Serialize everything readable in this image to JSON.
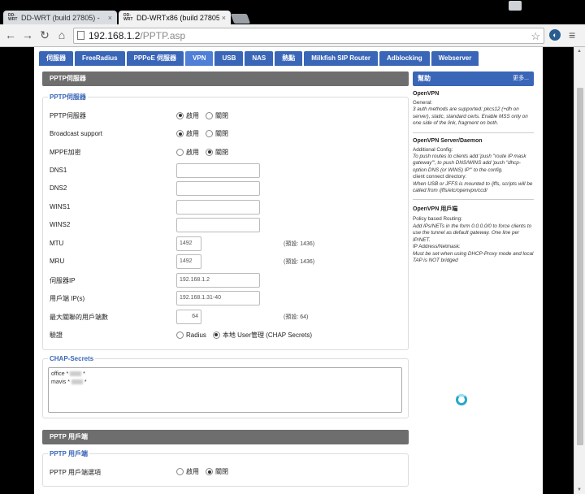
{
  "browser": {
    "tabs": [
      {
        "title": "DD-WRT (build 27805) - ",
        "favicon": "DD-WRT",
        "close": "×"
      },
      {
        "title": "DD-WRTx86 (build 27805",
        "favicon": "DD-WRT",
        "close": "×"
      }
    ],
    "url_host": "192.168.1.2",
    "url_path": "/PPTP.asp"
  },
  "nav": [
    "伺服器",
    "FreeRadius",
    "PPPoE 伺服器",
    "VPN",
    "USB",
    "NAS",
    "熱點",
    "Milkfish SIP Router",
    "Adblocking",
    "Webserver"
  ],
  "pptp_server": {
    "header": "PPTP伺服器",
    "legend": "PPTP伺服器",
    "enable": "啟用",
    "disable": "關閉",
    "rows": {
      "server": "PPTP伺服器",
      "broadcast": "Broadcast support",
      "mppe": "MPPE加密",
      "dns1": "DNS1",
      "dns2": "DNS2",
      "wins1": "WINS1",
      "wins2": "WINS2",
      "mtu": "MTU",
      "mru": "MRU",
      "server_ip": "伺服器IP",
      "client_ip": "用戶端 IP(s)",
      "max_conn": "最大關聯的用戶端數",
      "auth": "驗證"
    },
    "values": {
      "mtu": "1492",
      "mru": "1492",
      "server_ip": "192.168.1.2",
      "client_ip": "192.168.1.31-40",
      "max_conn": "64"
    },
    "hints": {
      "mtu": "(預設: 1436)",
      "mru": "(預設: 1436)",
      "max_conn": "(預設: 64)"
    },
    "auth_radius": "Radius",
    "auth_local": "本地 User管理 (CHAP Secrets)"
  },
  "chap": {
    "legend": "CHAP-Secrets",
    "line1_user": "office * ",
    "line1_end": " *",
    "line2_user": "mavis * ",
    "line2_end": " *"
  },
  "pptp_client": {
    "header": "PPTP 用戶端",
    "legend": "PPTP 用戶端",
    "option_label": "PPTP 用戶端選項",
    "enable": "啟用",
    "disable": "關閉"
  },
  "help": {
    "title": "幫助",
    "more": "更多...",
    "sections": [
      {
        "title": "OpenVPN",
        "lines": [
          "General:",
          "3 auth methods are supported: pkcs12 (+dh on server), static, standard certs. Enable MSS only on one side of the link, fragment on both."
        ]
      },
      {
        "title": "OpenVPN Server/Daemon",
        "lines": [
          "Additional Config:",
          "To push routes to clients add 'push \"route IP mask gateway\"', to push DNS/WINS add 'push \"dhcp-option DNS (or WINS) IP\"' to the config.",
          "client connect directory:",
          "When USB or JFFS is mounted to /jffs, scripts will be called from /jffs/etc/openvpn/ccd/"
        ]
      },
      {
        "title": "OpenVPN 用戶端",
        "lines": [
          "Policy based Routing:",
          "Add IPs/NETs in the form 0.0.0.0/0 to force clients to use the tunnel as default gateway. One line per IP/NET.",
          "IP Address/Netmask:",
          "Must be set when using DHCP-Proxy mode and local TAP is NOT bridged"
        ]
      }
    ]
  }
}
